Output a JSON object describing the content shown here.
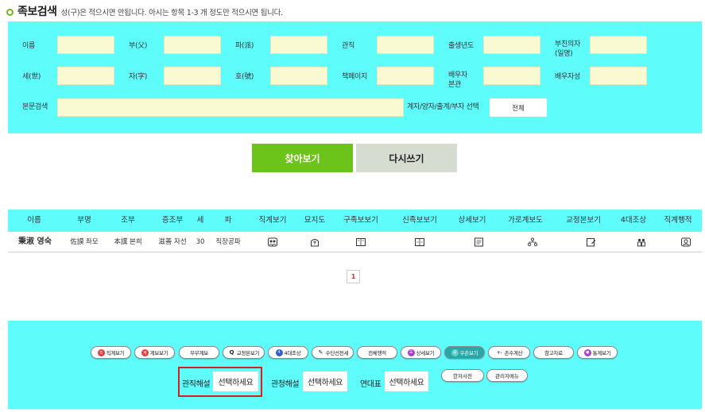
{
  "header": {
    "title": "족보검색",
    "subtitle": "성(구)은 적으시면 안됩니다. 아시는 항목 1-3 개 정도만 적으시면 됩니다."
  },
  "form": {
    "row1": [
      "이름",
      "부(父)",
      "파(派)",
      "관직",
      "출생년도"
    ],
    "row1_last_a": "부친의자",
    "row1_last_b": "(일명)",
    "row2": [
      "세(世)",
      "자(字)",
      "호(號)",
      "책페이지"
    ],
    "row2_spouse_a": "배우자",
    "row2_spouse_b": "본관",
    "row2_last": "배우자성",
    "body_search": "본문검색",
    "relation_label": "계자/양자/출계/부자 선택",
    "relation_value": "전체"
  },
  "buttons": {
    "find": "찾아보기",
    "reset": "다시쓰기"
  },
  "table": {
    "headers": [
      "이름",
      "부명",
      "조부",
      "증조부",
      "세",
      "파",
      "직계보기",
      "묘지도",
      "구족보보기",
      "신족보보기",
      "상세보기",
      "가로계보도",
      "교정본보기",
      "4대조상",
      "직계행적"
    ],
    "row": {
      "name": "秉淑 영숙",
      "father": "佐謨 좌모",
      "grandfather": "本讜 본희",
      "great_grandfather": "滋善 자선",
      "generation": "30",
      "branch": "직장공파"
    },
    "row_icons": [
      "family-icon",
      "tomb-icon",
      "book-icon",
      "book-icon",
      "detail-icon",
      "tree-icon",
      "edit-icon",
      "ancestors-icon",
      "person-icon"
    ]
  },
  "pagination": {
    "current": "1"
  },
  "bottom": {
    "pills": [
      {
        "label": "직계보기",
        "dot": "직",
        "color": "#e23a3a"
      },
      {
        "label": "계보보기",
        "dot": "계",
        "color": "#e23a3a"
      },
      {
        "label": "부부계보",
        "dot": "",
        "color": ""
      },
      {
        "label": "교정본보기",
        "dot": "Q",
        "color": ""
      },
      {
        "label": "4대조상",
        "dot": "4",
        "color": "#2f5cd6"
      },
      {
        "label": "수단선전세",
        "dot": "✎",
        "color": ""
      },
      {
        "label": "전체행적",
        "dot": "",
        "color": ""
      },
      {
        "label": "상세보기",
        "dot": "☰",
        "color": "#b03ad6"
      },
      {
        "label": "우촌보기",
        "dot": "우",
        "color": "#2aa7a7"
      },
      {
        "label": "촌수계산",
        "dot": "+-",
        "color": ""
      },
      {
        "label": "참고자료",
        "dot": "",
        "color": ""
      },
      {
        "label": "통계보기",
        "dot": "●",
        "color": "#b03ad6"
      }
    ],
    "pills2": [
      "한자사전",
      "관리자메뉴"
    ],
    "gwanjik_label": "관직해설",
    "gwanjik_value": "선택하세요",
    "gwancheong_label": "관청해설",
    "gwancheong_value": "선택하세요",
    "yeondae_label": "연대표",
    "yeondae_value": "선택하세요"
  },
  "colors": {
    "panel": "#5ffcfc",
    "field": "#fafad2",
    "find_button": "#6cc41a",
    "reset_button": "#d6dcd0",
    "highlight": "#d62020"
  }
}
